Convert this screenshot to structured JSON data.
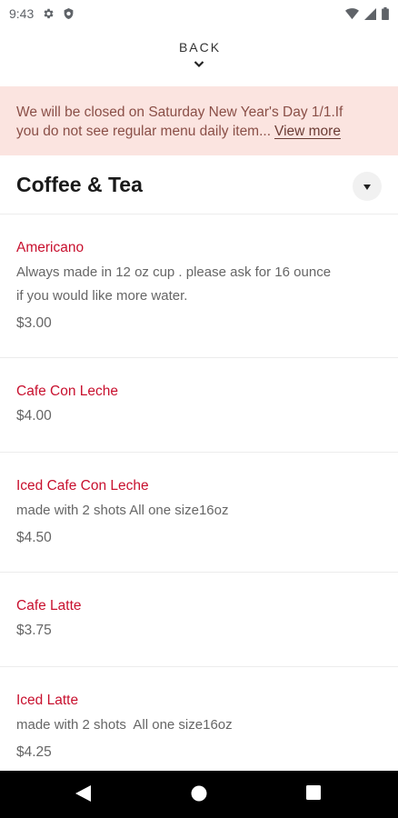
{
  "status_bar": {
    "time": "9:43",
    "left_icons": [
      "gear-icon",
      "shield-icon"
    ],
    "right_icons": [
      "wifi-icon",
      "cell-signal-icon",
      "battery-icon"
    ]
  },
  "nav": {
    "back_label": "BACK"
  },
  "banner": {
    "line1": "We will be closed on Saturday New Year's Day 1/1.If",
    "line2": "you do not see regular menu daily item...",
    "link": "View more"
  },
  "section": {
    "title": "Coffee & Tea"
  },
  "menu_items": [
    {
      "name": "Americano",
      "description": [
        "Always made in 12 oz cup . please ask for 16 ounce",
        "if you would like more water."
      ],
      "price": "$3.00"
    },
    {
      "name": "Cafe Con Leche",
      "description": [],
      "price": "$4.00"
    },
    {
      "name": "Iced Cafe Con Leche",
      "description": [
        "made with 2 shots All one size16oz"
      ],
      "price": "$4.50"
    },
    {
      "name": "Cafe Latte",
      "description": [],
      "price": "$3.75"
    },
    {
      "name": "Iced Latte",
      "description": [
        "made with 2 shots  All one size16oz"
      ],
      "price": "$4.25"
    }
  ],
  "system_nav": {
    "buttons": [
      "back-triangle-icon",
      "home-circle-icon",
      "recents-square-icon"
    ]
  },
  "colors": {
    "banner_bg": "#fbe4e0",
    "item_name": "#c8102e",
    "muted_text": "#666666",
    "nav_bar": "#000000"
  }
}
